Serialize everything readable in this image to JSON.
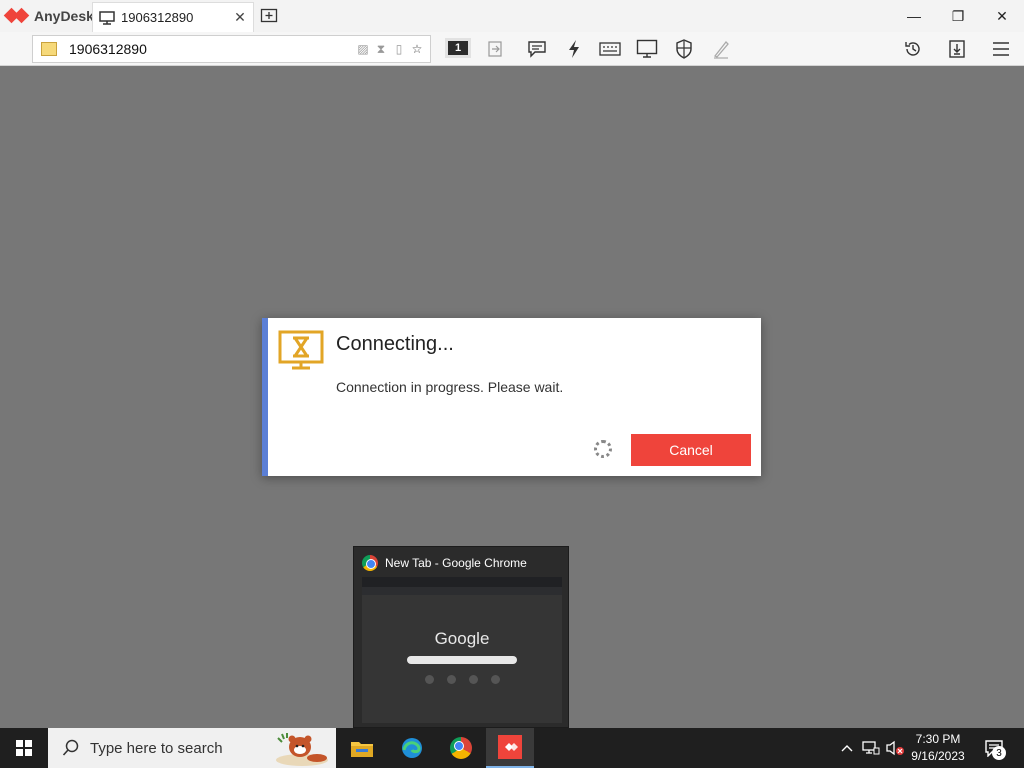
{
  "app": {
    "brand": "AnyDesk",
    "tab_title": "1906312890",
    "tab_close": "✕"
  },
  "window": {
    "minimize": "—",
    "restore": "❐",
    "close": "✕"
  },
  "toolbar": {
    "address_value": "1906312890",
    "monitor_number": "1"
  },
  "dialog": {
    "title": "Connecting...",
    "message": "Connection in progress. Please wait.",
    "cancel_label": "Cancel"
  },
  "thumbnail": {
    "title": "New Tab - Google Chrome",
    "brand_text": "Google"
  },
  "taskbar": {
    "search_placeholder": "Type here to search",
    "time": "7:30 PM",
    "date": "9/16/2023",
    "notification_count": "3"
  },
  "colors": {
    "accent": "#ef443b",
    "dialog_border": "#5b7fd6",
    "hourglass": "#e2a526"
  }
}
